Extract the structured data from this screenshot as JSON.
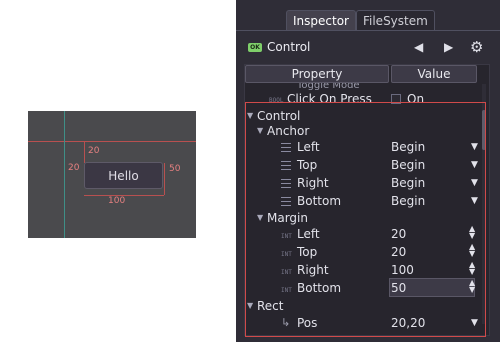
{
  "viewport": {
    "button_label": "Hello",
    "margin_top": "20",
    "margin_left": "20",
    "margin_right": "50",
    "margin_bottom": "100"
  },
  "inspector": {
    "tabs": [
      "Inspector",
      "FileSystem"
    ],
    "node_icon": "OK",
    "node_title": "Control",
    "header": {
      "property": "Property",
      "value": "Value"
    },
    "truncated_row": "Toggle Mode",
    "click_on_press": {
      "tag": "BOOL",
      "label": "Click On Press",
      "value": "On"
    },
    "control_section": "Control",
    "anchor_section": "Anchor",
    "anchor": [
      {
        "label": "Left",
        "value": "Begin"
      },
      {
        "label": "Top",
        "value": "Begin"
      },
      {
        "label": "Right",
        "value": "Begin"
      },
      {
        "label": "Bottom",
        "value": "Begin"
      }
    ],
    "margin_section": "Margin",
    "int_tag": "INT",
    "margin": [
      {
        "label": "Left",
        "value": "20"
      },
      {
        "label": "Top",
        "value": "20"
      },
      {
        "label": "Right",
        "value": "100"
      },
      {
        "label": "Bottom",
        "value": "50"
      }
    ],
    "rect_section": "Rect",
    "pos": {
      "label": "Pos",
      "value": "20,20"
    }
  },
  "icons": {
    "node": "node-type-icon",
    "back": "arrow-left-icon",
    "forward": "arrow-right-icon",
    "settings": "gear-icon",
    "dropdown": "chevron-down-icon",
    "spinner": "spinner-arrows-icon",
    "enum": "list-icon"
  },
  "colors": {
    "selection": "#d04a4a",
    "node_icon": "#7fcf6a",
    "panel_bg": "#2f2d37"
  }
}
